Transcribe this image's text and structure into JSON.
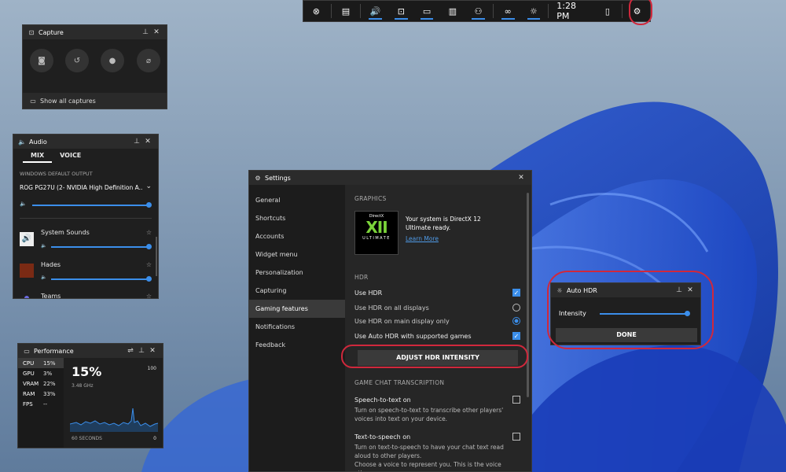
{
  "gamebar": {
    "time": "1:28 PM",
    "icons": [
      "xbox-icon",
      "widget-menu-icon",
      "audio-icon",
      "capture-icon",
      "performance-icon",
      "resources-icon",
      "xbox-social-icon",
      "looking-for-group-icon",
      "auto-hdr-icon",
      "mouse-icon",
      "settings-icon"
    ]
  },
  "capture": {
    "title": "Capture",
    "show_all": "Show all captures"
  },
  "audio": {
    "title": "Audio",
    "tabs": [
      "MIX",
      "VOICE"
    ],
    "output_label": "WINDOWS DEFAULT OUTPUT",
    "output_device": "ROG PG27U (2- NVIDIA High Definition A...",
    "master_volume": 1.0,
    "apps": [
      {
        "name": "System Sounds",
        "volume": 1.0
      },
      {
        "name": "Hades",
        "volume": 1.0
      },
      {
        "name": "Teams",
        "volume": 1.0
      }
    ]
  },
  "performance": {
    "title": "Performance",
    "stats": [
      {
        "k": "CPU",
        "v": "15%"
      },
      {
        "k": "GPU",
        "v": "3%"
      },
      {
        "k": "VRAM",
        "v": "22%"
      },
      {
        "k": "RAM",
        "v": "33%"
      },
      {
        "k": "FPS",
        "v": "--"
      }
    ],
    "big_value": "15%",
    "clock": "3.48 GHz",
    "max": "100",
    "min": "0",
    "window": "60 SECONDS"
  },
  "settings": {
    "title": "Settings",
    "nav": [
      "General",
      "Shortcuts",
      "Accounts",
      "Widget menu",
      "Personalization",
      "Capturing",
      "Gaming features",
      "Notifications",
      "Feedback"
    ],
    "selected_nav": "Gaming features",
    "graphics_header": "GRAPHICS",
    "dx_logo_top": "DirectX",
    "dx_logo_mid": "XII",
    "dx_logo_bottom": "ULTIMATE",
    "dx_text": "Your system is DirectX 12 Ultimate ready.",
    "learn_more": "Learn More",
    "hdr_header": "HDR",
    "use_hdr": "Use HDR",
    "use_hdr_all": "Use HDR on all displays",
    "use_hdr_main": "Use HDR on main display only",
    "use_auto_hdr": "Use Auto HDR with supported games",
    "adjust_button": "ADJUST HDR INTENSITY",
    "chat_header": "GAME CHAT TRANSCRIPTION",
    "stt_title": "Speech-to-text on",
    "stt_desc": "Turn on speech-to-text to transcribe other players' voices into text on your device.",
    "tts_title": "Text-to-speech on",
    "tts_desc": "Turn on text-to-speech to have your chat text read aloud to other players.",
    "tts_desc2": "Choose a voice to represent you. This is the voice other"
  },
  "autohdr": {
    "title": "Auto HDR",
    "intensity_label": "Intensity",
    "intensity": 1.0,
    "done": "DONE"
  },
  "colors": {
    "accent": "#3b8eea",
    "highlight": "#d0283c",
    "dx_green": "#7bd33a"
  }
}
